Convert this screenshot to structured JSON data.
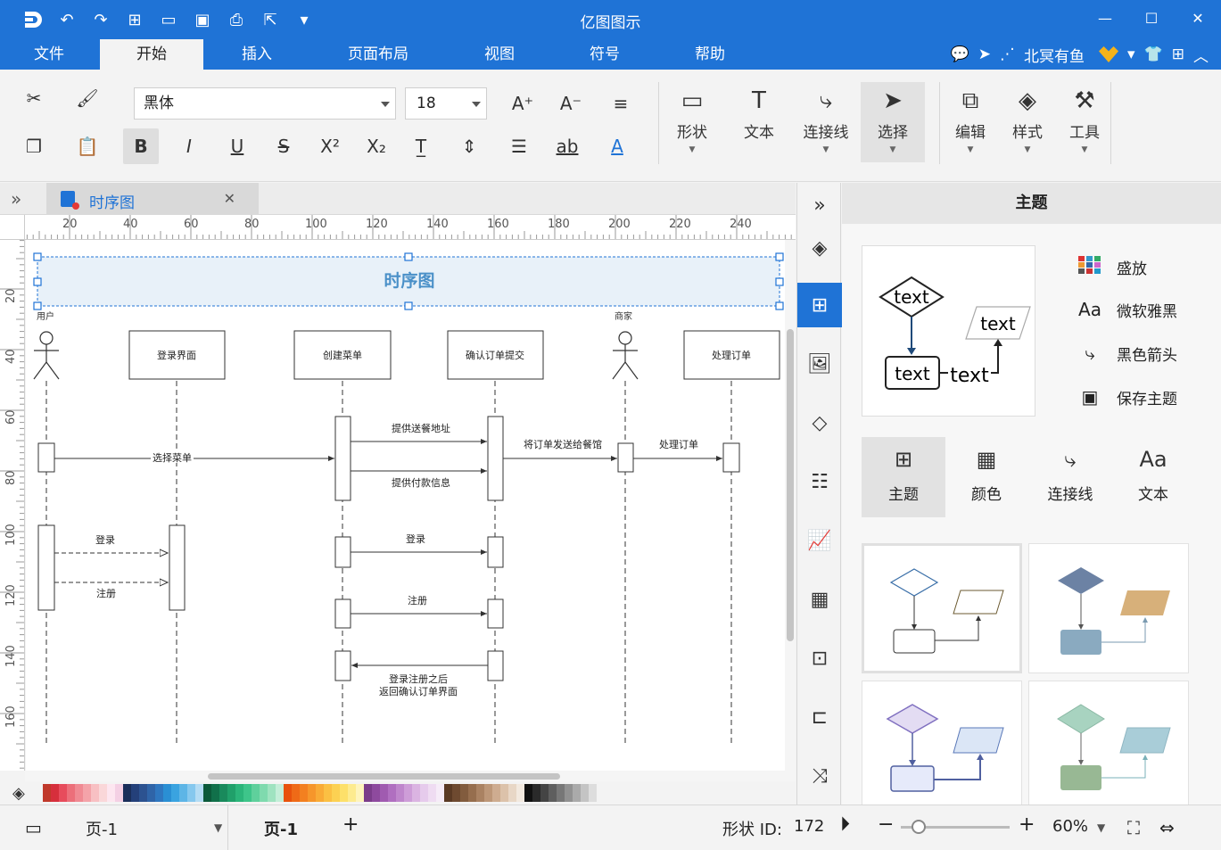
{
  "app": {
    "title": "亿图图示"
  },
  "menu": {
    "tabs": [
      "文件",
      "开始",
      "插入",
      "页面布局",
      "视图",
      "符号",
      "帮助"
    ],
    "active_index": 1,
    "user_name": "北冥有鱼"
  },
  "ribbon": {
    "font_family": "黑体",
    "font_size": "18",
    "big_buttons": [
      {
        "label": "形状",
        "icon": "rectangle-icon"
      },
      {
        "label": "文本",
        "icon": "text-icon"
      },
      {
        "label": "连接线",
        "icon": "connector-icon"
      },
      {
        "label": "选择",
        "icon": "pointer-icon"
      },
      {
        "label": "编辑",
        "icon": "edit-icon"
      },
      {
        "label": "样式",
        "icon": "paint-bucket-icon"
      },
      {
        "label": "工具",
        "icon": "tools-icon"
      }
    ]
  },
  "document": {
    "tab_name": "时序图"
  },
  "ruler": {
    "h_labels": [
      "20",
      "40",
      "60",
      "80",
      "100",
      "120",
      "140",
      "160",
      "180",
      "200",
      "220",
      "240"
    ],
    "v_labels": [
      "20",
      "40",
      "60",
      "80",
      "100",
      "120",
      "140",
      "160"
    ]
  },
  "diagram": {
    "title": "时序图",
    "actor_user": "用户",
    "actor_merchant": "商家",
    "boxes": [
      "登录界面",
      "创建菜单",
      "确认订单提交",
      "处理订单"
    ],
    "messages": {
      "select_menu": "选择菜单",
      "provide_address": "提供送餐地址",
      "provide_payment": "提供付款信息",
      "send_order": "将订单发送给餐馆",
      "process_order": "处理订单",
      "login_1": "登录",
      "register_1": "注册",
      "login_2": "登录",
      "register_2": "注册",
      "return_line1": "登录注册之后",
      "return_line2": "返回确认订单界面"
    }
  },
  "panel": {
    "title": "主题",
    "preview_text": "text",
    "options": [
      {
        "label": "盛放",
        "icon": "palette-grid-icon"
      },
      {
        "label": "微软雅黑",
        "icon": "font-icon"
      },
      {
        "label": "黑色箭头",
        "icon": "connector-arrow-icon"
      },
      {
        "label": "保存主题",
        "icon": "save-icon"
      }
    ],
    "tabs": [
      {
        "label": "主题",
        "icon": "grid-icon"
      },
      {
        "label": "颜色",
        "icon": "color-table-icon"
      },
      {
        "label": "连接线",
        "icon": "connector-icon"
      },
      {
        "label": "文本",
        "icon": "font-icon"
      }
    ]
  },
  "status": {
    "page_selector": "页-1",
    "page_tab": "页-1",
    "shape_id_label": "形状 ID:",
    "shape_id_value": "172",
    "zoom": "60%"
  },
  "colors": {
    "brand": "#1f73d6",
    "palette": [
      "#c0392b",
      "#d62f3c",
      "#e74c5c",
      "#ec6f7a",
      "#f08a93",
      "#f4a3a9",
      "#f8c0c3",
      "#fad7d9",
      "#fde6f0",
      "#f4d0e4",
      "#1a2e5a",
      "#24407a",
      "#2c5290",
      "#2f64a8",
      "#2f77c0",
      "#2a8fd4",
      "#3aa3e0",
      "#5db5e6",
      "#86c8ee",
      "#b4dcf4",
      "#0b5a3a",
      "#11704a",
      "#198a5c",
      "#20a06a",
      "#2bb57a",
      "#3ec58a",
      "#5fd09c",
      "#7fdaae",
      "#9fe3c0",
      "#c4eed8",
      "#e8520c",
      "#ef6a17",
      "#f38020",
      "#f6962b",
      "#f9ab36",
      "#fbc043",
      "#fcd152",
      "#fde06a",
      "#fdeb8f",
      "#fef4bc",
      "#7b3c8a",
      "#8e4a9e",
      "#a05bb0",
      "#b06fc0",
      "#bf86cc",
      "#ce9dd8",
      "#dbb4e2",
      "#e6cbec",
      "#efdcf2",
      "#f6ecf8",
      "#5a3a24",
      "#6e4a30",
      "#825c3e",
      "#966e4e",
      "#aa8262",
      "#bd9778",
      "#ceac90",
      "#dcc2aa",
      "#e8d7c6",
      "#f2e9df",
      "#111111",
      "#2a2a2a",
      "#444444",
      "#5e5e5e",
      "#777777",
      "#919191",
      "#aaaaaa",
      "#c4c4c4",
      "#dddddd",
      "#f3f3f3"
    ]
  }
}
